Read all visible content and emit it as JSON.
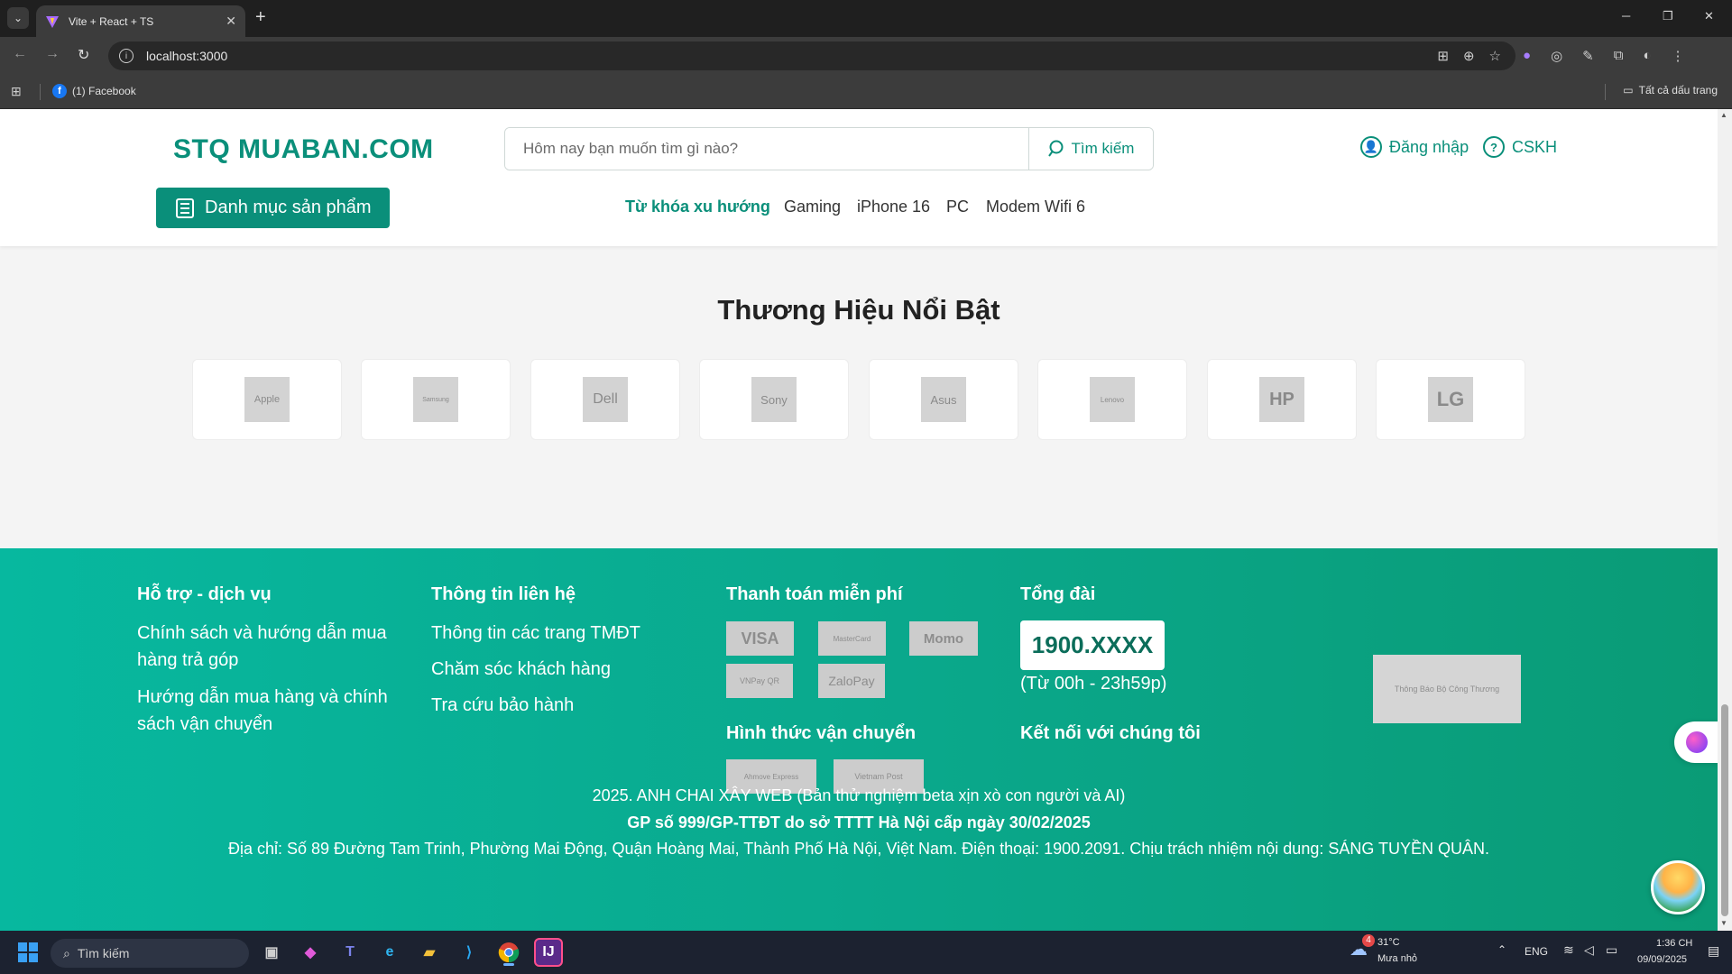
{
  "browser": {
    "tab_title": "Vite + React + TS",
    "url": "localhost:3000",
    "bookmark_facebook": "(1) Facebook",
    "bookmark_all": "Tất cả dấu trang"
  },
  "header": {
    "logo": "STQ MUABAN.COM",
    "search_placeholder": "Hôm nay bạn muốn tìm gì nào?",
    "search_button": "Tìm kiếm",
    "login": "Đăng nhập",
    "support": "CSKH",
    "category_button": "Danh mục sản phẩm",
    "trending_label": "Từ khóa xu hướng",
    "trending": [
      "Gaming",
      "iPhone 16",
      "PC",
      "Modem Wifi 6"
    ]
  },
  "brands": {
    "title": "Thương Hiệu Nổi Bật",
    "items": [
      "Apple",
      "Samsung",
      "Dell",
      "Sony",
      "Asus",
      "Lenovo",
      "HP",
      "LG"
    ]
  },
  "footer": {
    "support_heading": "Hỗ trợ - dịch vụ",
    "support_links": [
      "Chính sách và hướng dẫn mua hàng trả góp",
      "Hướng dẫn mua hàng và chính sách vận chuyển"
    ],
    "contact_heading": "Thông tin liên hệ",
    "contact_links": [
      "Thông tin các trang TMĐT",
      "Chăm sóc khách hàng",
      "Tra cứu bảo hành"
    ],
    "payment_heading": "Thanh toán miễn phí",
    "payments": [
      "VISA",
      "MasterCard",
      "Momo",
      "VNPay QR",
      "ZaloPay"
    ],
    "shipping_heading": "Hình thức vận chuyển",
    "shipping": [
      "Ahmove Express",
      "Vietnam Post"
    ],
    "hotline_heading": "Tổng đài",
    "hotline": "1900.XXXX",
    "hotline_hours": "(Từ 00h - 23h59p)",
    "connect_heading": "Kết nối với chúng tôi",
    "gov_badge": "Thông Báo Bộ Công Thương",
    "copyright": "2025. ANH CHAI XÂY WEB (Bản thử nghiệm beta xịn xò con người và AI)",
    "license": "GP số 999/GP-TTĐT do sở TTTT Hà Nội cấp ngày 30/02/2025",
    "address": "Địa chỉ: Số 89 Đường Tam Trinh, Phường Mai Động, Quận Hoàng Mai, Thành Phố Hà Nội, Việt Nam. Điện thoại: 1900.2091. Chịu trách nhiệm nội dung: SÁNG TUYỀN QUÂN."
  },
  "taskbar": {
    "search": "Tìm kiếm",
    "weather_temp": "31°C",
    "weather_desc": "Mưa nhỏ",
    "weather_badge": "4",
    "language": "ENG",
    "time": "1:36 CH",
    "date": "09/09/2025"
  }
}
